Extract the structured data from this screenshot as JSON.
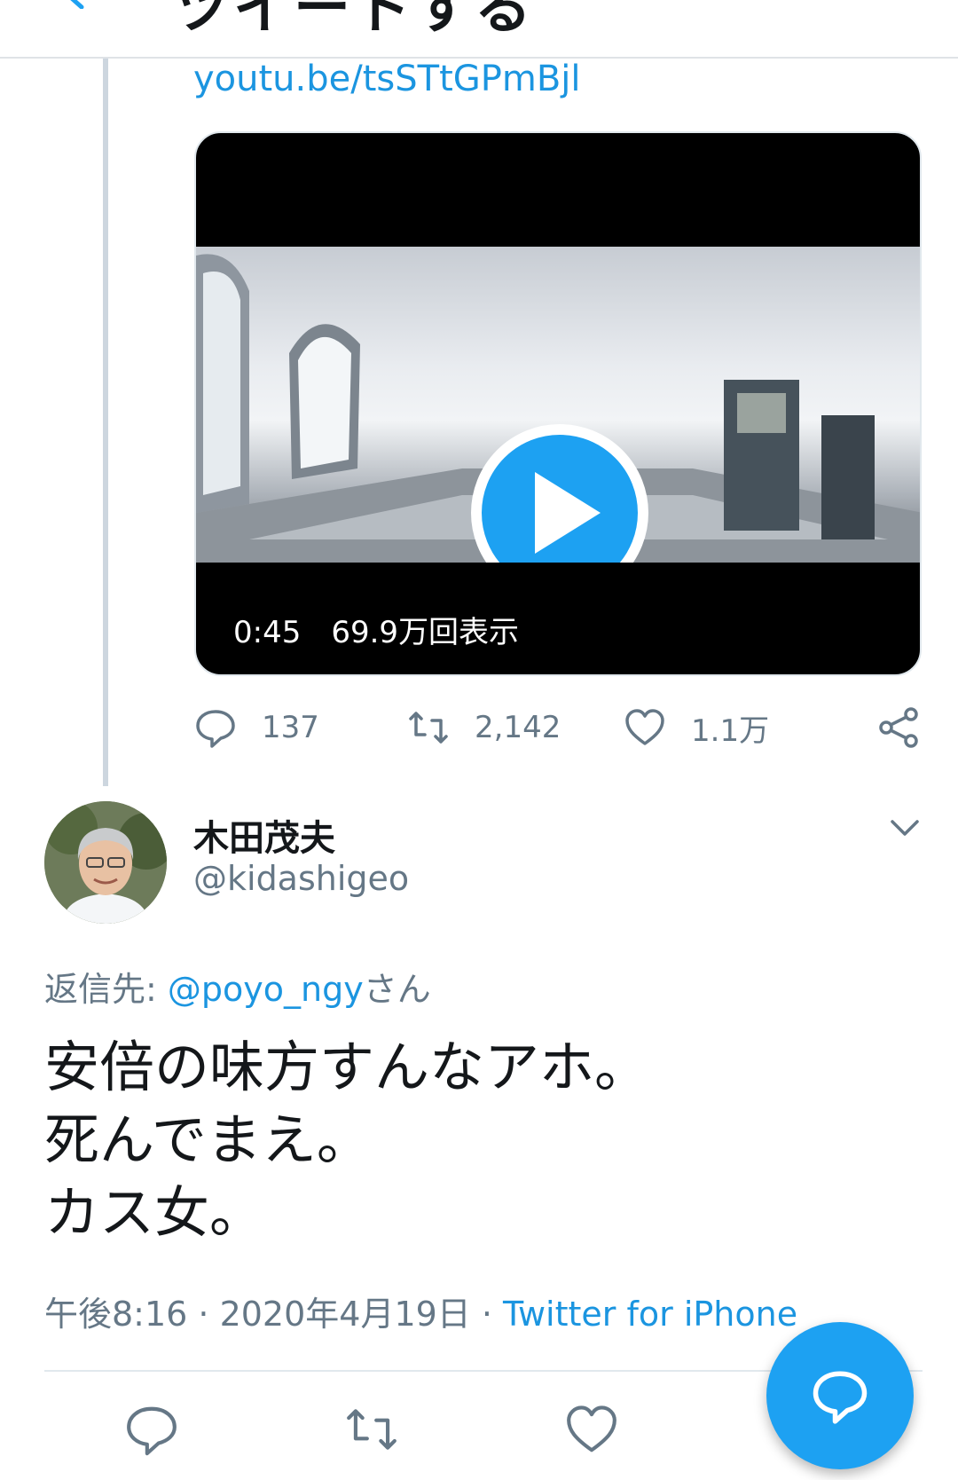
{
  "header": {
    "title": "ツイートする"
  },
  "tweet": {
    "link": "youtu.be/tsSTtGPmBjl",
    "video": {
      "duration": "0:45",
      "views": "69.9万回表示"
    },
    "actions": {
      "replies": "137",
      "retweets": "2,142",
      "likes": "1.1万"
    }
  },
  "reply": {
    "author_name": "木田茂夫",
    "author_handle": "@kidashigeo",
    "reply_label": "返信先: ",
    "reply_mention": "@poyo_ngy",
    "reply_suffix": "さん",
    "body_lines": [
      "安倍の味方すんなアホ。",
      "死んでまえ。",
      "カス女。"
    ],
    "time": "午後8:16 · 2020年4月19日 · ",
    "source": "Twitter for iPhone"
  },
  "colors": {
    "accent": "#1da1f2",
    "link": "#1b95e0",
    "muted": "#657786"
  }
}
